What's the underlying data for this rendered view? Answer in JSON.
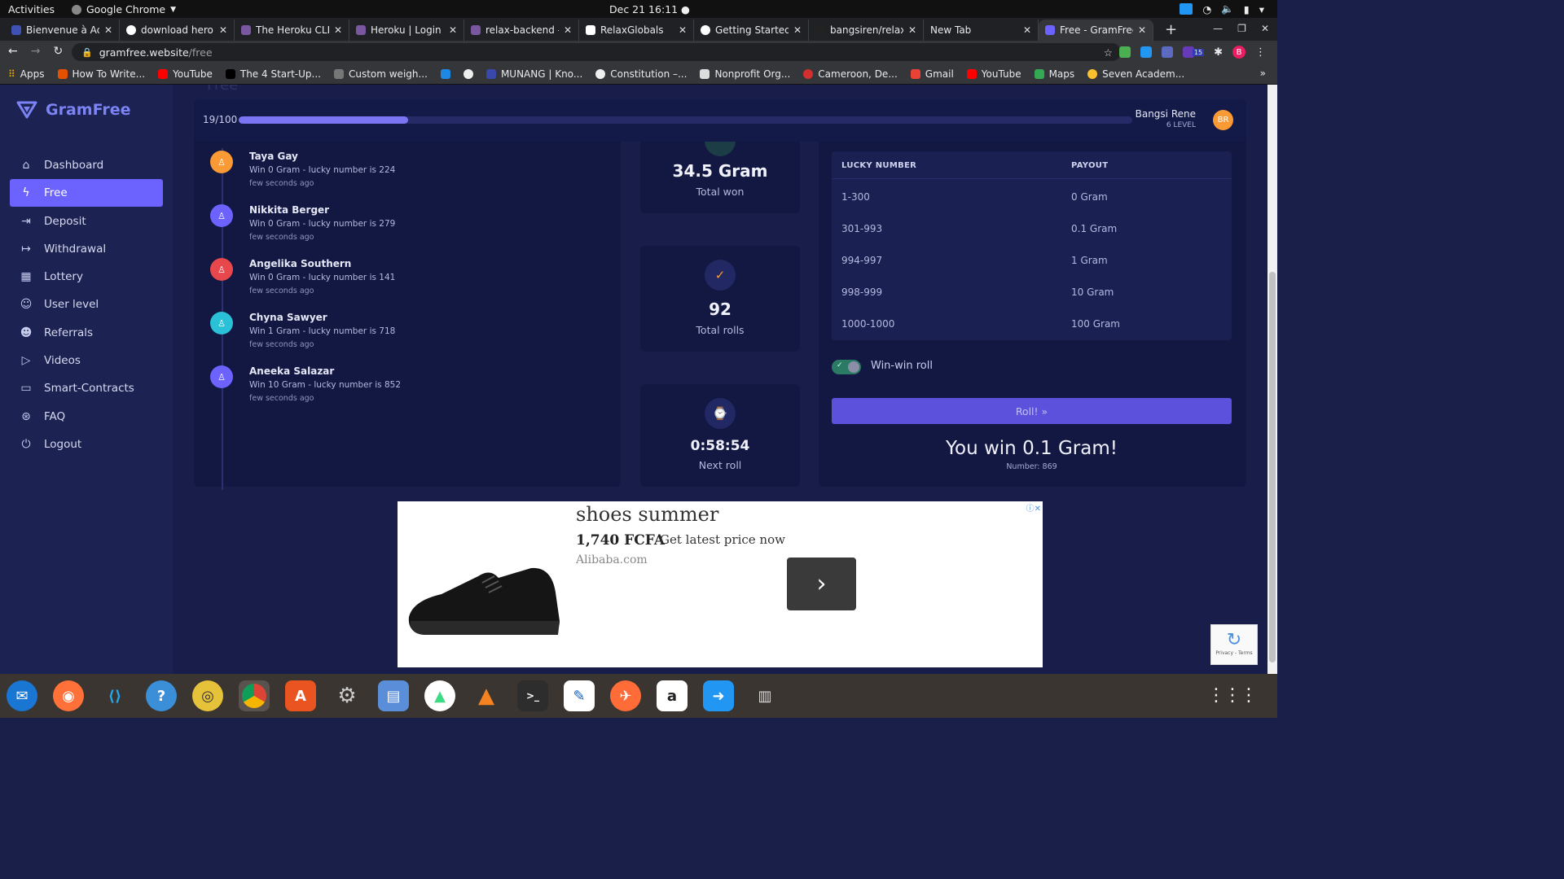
{
  "system": {
    "activities": "Activities",
    "app_name": "Google Chrome",
    "clock": "Dec 21  16:11 ●"
  },
  "tabs": [
    {
      "label": "Bienvenue à Act"
    },
    {
      "label": "download hero"
    },
    {
      "label": "The Heroku CLI"
    },
    {
      "label": "Heroku | Login"
    },
    {
      "label": "relax-backend -"
    },
    {
      "label": "RelaxGlobals"
    },
    {
      "label": "Getting Started"
    },
    {
      "label": "bangsiren/relax"
    },
    {
      "label": "New Tab"
    },
    {
      "label": "Free - GramFree"
    }
  ],
  "address": {
    "domain": "gramfree.website",
    "path": "/free"
  },
  "extensions": {
    "badge": "15",
    "profile": "B"
  },
  "bookmarks": [
    "Apps",
    "How To Write...",
    "YouTube",
    "The 4 Start-Up...",
    "Custom weigh...",
    "",
    "",
    "MUNANG | Kno...",
    "Constitution –...",
    "Nonprofit Org...",
    "Cameroon, De...",
    "Gmail",
    "YouTube",
    "Maps",
    "Seven Academ..."
  ],
  "sidebar": {
    "brand": "GramFree",
    "items": [
      {
        "label": "Dashboard",
        "icon": "home-icon"
      },
      {
        "label": "Free",
        "icon": "bolt-icon"
      },
      {
        "label": "Deposit",
        "icon": "login-icon"
      },
      {
        "label": "Withdrawal",
        "icon": "logout-icon"
      },
      {
        "label": "Lottery",
        "icon": "grid-icon"
      },
      {
        "label": "User level",
        "icon": "user-icon"
      },
      {
        "label": "Referrals",
        "icon": "users-icon"
      },
      {
        "label": "Videos",
        "icon": "play-icon"
      },
      {
        "label": "Smart-Contracts",
        "icon": "folder-icon"
      },
      {
        "label": "FAQ",
        "icon": "lifebuoy-icon"
      },
      {
        "label": "Logout",
        "icon": "power-icon"
      }
    ]
  },
  "page": {
    "ghost_title": "Free",
    "progress_label": "19/100",
    "progress_value": 0.19,
    "user_name": "Bangsi Rene",
    "user_level": "6 LEVEL",
    "user_initials": "BR"
  },
  "feed": [
    {
      "name": "Taya Gay",
      "desc": "Win 0 Gram - lucky number is 224",
      "time": "few seconds ago",
      "color": "#f99a35"
    },
    {
      "name": "Nikkita Berger",
      "desc": "Win 0 Gram - lucky number is 279",
      "time": "few seconds ago",
      "color": "#6c63ff"
    },
    {
      "name": "Angelika Southern",
      "desc": "Win 0 Gram - lucky number is 141",
      "time": "few seconds ago",
      "color": "#e8474c"
    },
    {
      "name": "Chyna Sawyer",
      "desc": "Win 1 Gram - lucky number is 718",
      "time": "few seconds ago",
      "color": "#2ac1d8"
    },
    {
      "name": "Aneeka Salazar",
      "desc": "Win 10 Gram - lucky number is 852",
      "time": "few seconds ago",
      "color": "#6c63ff"
    }
  ],
  "stats": {
    "total_won_value": "34.5 Gram",
    "total_won_label": "Total won",
    "total_rolls_value": "92",
    "total_rolls_label": "Total rolls",
    "next_roll_value": "0:58:54",
    "next_roll_label": "Next roll"
  },
  "payout_table": {
    "headers": [
      "LUCKY NUMBER",
      "PAYOUT"
    ],
    "rows": [
      [
        "1-300",
        "0 Gram"
      ],
      [
        "301-993",
        "0.1 Gram"
      ],
      [
        "994-997",
        "1 Gram"
      ],
      [
        "998-999",
        "10 Gram"
      ],
      [
        "1000-1000",
        "100 Gram"
      ]
    ]
  },
  "roll": {
    "toggle_label": "Win-win roll",
    "toggle_on": true,
    "button_label": "Roll! »",
    "result": "You win 0.1 Gram!",
    "number": "Number: 869"
  },
  "ad": {
    "title": "shoes summer",
    "price": "1,740 FCFA",
    "cta": "Get latest price now",
    "source": "Alibaba.com"
  },
  "recaptcha": {
    "text": "Privacy - Terms"
  },
  "colors": {
    "accent": "#6c63ff",
    "sidebar_bg": "#1c2252",
    "panel_bg": "#131842"
  }
}
